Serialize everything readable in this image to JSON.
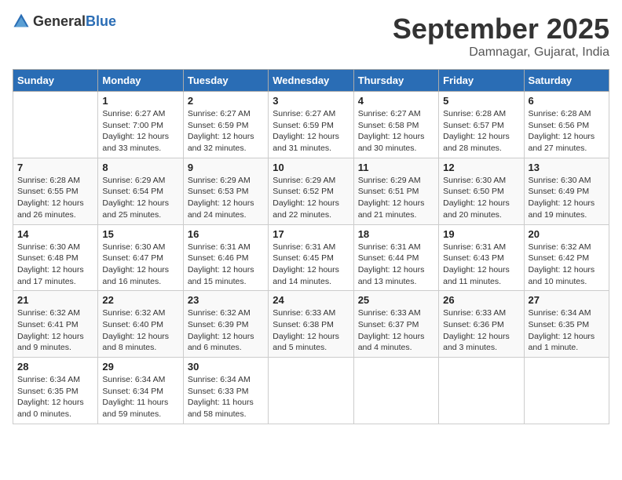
{
  "header": {
    "logo_general": "General",
    "logo_blue": "Blue",
    "title": "September 2025",
    "subtitle": "Damnagar, Gujarat, India"
  },
  "columns": [
    "Sunday",
    "Monday",
    "Tuesday",
    "Wednesday",
    "Thursday",
    "Friday",
    "Saturday"
  ],
  "weeks": [
    [
      {
        "day": "",
        "sunrise": "",
        "sunset": "",
        "daylight": ""
      },
      {
        "day": "1",
        "sunrise": "Sunrise: 6:27 AM",
        "sunset": "Sunset: 7:00 PM",
        "daylight": "Daylight: 12 hours and 33 minutes."
      },
      {
        "day": "2",
        "sunrise": "Sunrise: 6:27 AM",
        "sunset": "Sunset: 6:59 PM",
        "daylight": "Daylight: 12 hours and 32 minutes."
      },
      {
        "day": "3",
        "sunrise": "Sunrise: 6:27 AM",
        "sunset": "Sunset: 6:59 PM",
        "daylight": "Daylight: 12 hours and 31 minutes."
      },
      {
        "day": "4",
        "sunrise": "Sunrise: 6:27 AM",
        "sunset": "Sunset: 6:58 PM",
        "daylight": "Daylight: 12 hours and 30 minutes."
      },
      {
        "day": "5",
        "sunrise": "Sunrise: 6:28 AM",
        "sunset": "Sunset: 6:57 PM",
        "daylight": "Daylight: 12 hours and 28 minutes."
      },
      {
        "day": "6",
        "sunrise": "Sunrise: 6:28 AM",
        "sunset": "Sunset: 6:56 PM",
        "daylight": "Daylight: 12 hours and 27 minutes."
      }
    ],
    [
      {
        "day": "7",
        "sunrise": "Sunrise: 6:28 AM",
        "sunset": "Sunset: 6:55 PM",
        "daylight": "Daylight: 12 hours and 26 minutes."
      },
      {
        "day": "8",
        "sunrise": "Sunrise: 6:29 AM",
        "sunset": "Sunset: 6:54 PM",
        "daylight": "Daylight: 12 hours and 25 minutes."
      },
      {
        "day": "9",
        "sunrise": "Sunrise: 6:29 AM",
        "sunset": "Sunset: 6:53 PM",
        "daylight": "Daylight: 12 hours and 24 minutes."
      },
      {
        "day": "10",
        "sunrise": "Sunrise: 6:29 AM",
        "sunset": "Sunset: 6:52 PM",
        "daylight": "Daylight: 12 hours and 22 minutes."
      },
      {
        "day": "11",
        "sunrise": "Sunrise: 6:29 AM",
        "sunset": "Sunset: 6:51 PM",
        "daylight": "Daylight: 12 hours and 21 minutes."
      },
      {
        "day": "12",
        "sunrise": "Sunrise: 6:30 AM",
        "sunset": "Sunset: 6:50 PM",
        "daylight": "Daylight: 12 hours and 20 minutes."
      },
      {
        "day": "13",
        "sunrise": "Sunrise: 6:30 AM",
        "sunset": "Sunset: 6:49 PM",
        "daylight": "Daylight: 12 hours and 19 minutes."
      }
    ],
    [
      {
        "day": "14",
        "sunrise": "Sunrise: 6:30 AM",
        "sunset": "Sunset: 6:48 PM",
        "daylight": "Daylight: 12 hours and 17 minutes."
      },
      {
        "day": "15",
        "sunrise": "Sunrise: 6:30 AM",
        "sunset": "Sunset: 6:47 PM",
        "daylight": "Daylight: 12 hours and 16 minutes."
      },
      {
        "day": "16",
        "sunrise": "Sunrise: 6:31 AM",
        "sunset": "Sunset: 6:46 PM",
        "daylight": "Daylight: 12 hours and 15 minutes."
      },
      {
        "day": "17",
        "sunrise": "Sunrise: 6:31 AM",
        "sunset": "Sunset: 6:45 PM",
        "daylight": "Daylight: 12 hours and 14 minutes."
      },
      {
        "day": "18",
        "sunrise": "Sunrise: 6:31 AM",
        "sunset": "Sunset: 6:44 PM",
        "daylight": "Daylight: 12 hours and 13 minutes."
      },
      {
        "day": "19",
        "sunrise": "Sunrise: 6:31 AM",
        "sunset": "Sunset: 6:43 PM",
        "daylight": "Daylight: 12 hours and 11 minutes."
      },
      {
        "day": "20",
        "sunrise": "Sunrise: 6:32 AM",
        "sunset": "Sunset: 6:42 PM",
        "daylight": "Daylight: 12 hours and 10 minutes."
      }
    ],
    [
      {
        "day": "21",
        "sunrise": "Sunrise: 6:32 AM",
        "sunset": "Sunset: 6:41 PM",
        "daylight": "Daylight: 12 hours and 9 minutes."
      },
      {
        "day": "22",
        "sunrise": "Sunrise: 6:32 AM",
        "sunset": "Sunset: 6:40 PM",
        "daylight": "Daylight: 12 hours and 8 minutes."
      },
      {
        "day": "23",
        "sunrise": "Sunrise: 6:32 AM",
        "sunset": "Sunset: 6:39 PM",
        "daylight": "Daylight: 12 hours and 6 minutes."
      },
      {
        "day": "24",
        "sunrise": "Sunrise: 6:33 AM",
        "sunset": "Sunset: 6:38 PM",
        "daylight": "Daylight: 12 hours and 5 minutes."
      },
      {
        "day": "25",
        "sunrise": "Sunrise: 6:33 AM",
        "sunset": "Sunset: 6:37 PM",
        "daylight": "Daylight: 12 hours and 4 minutes."
      },
      {
        "day": "26",
        "sunrise": "Sunrise: 6:33 AM",
        "sunset": "Sunset: 6:36 PM",
        "daylight": "Daylight: 12 hours and 3 minutes."
      },
      {
        "day": "27",
        "sunrise": "Sunrise: 6:34 AM",
        "sunset": "Sunset: 6:35 PM",
        "daylight": "Daylight: 12 hours and 1 minute."
      }
    ],
    [
      {
        "day": "28",
        "sunrise": "Sunrise: 6:34 AM",
        "sunset": "Sunset: 6:35 PM",
        "daylight": "Daylight: 12 hours and 0 minutes."
      },
      {
        "day": "29",
        "sunrise": "Sunrise: 6:34 AM",
        "sunset": "Sunset: 6:34 PM",
        "daylight": "Daylight: 11 hours and 59 minutes."
      },
      {
        "day": "30",
        "sunrise": "Sunrise: 6:34 AM",
        "sunset": "Sunset: 6:33 PM",
        "daylight": "Daylight: 11 hours and 58 minutes."
      },
      {
        "day": "",
        "sunrise": "",
        "sunset": "",
        "daylight": ""
      },
      {
        "day": "",
        "sunrise": "",
        "sunset": "",
        "daylight": ""
      },
      {
        "day": "",
        "sunrise": "",
        "sunset": "",
        "daylight": ""
      },
      {
        "day": "",
        "sunrise": "",
        "sunset": "",
        "daylight": ""
      }
    ]
  ]
}
